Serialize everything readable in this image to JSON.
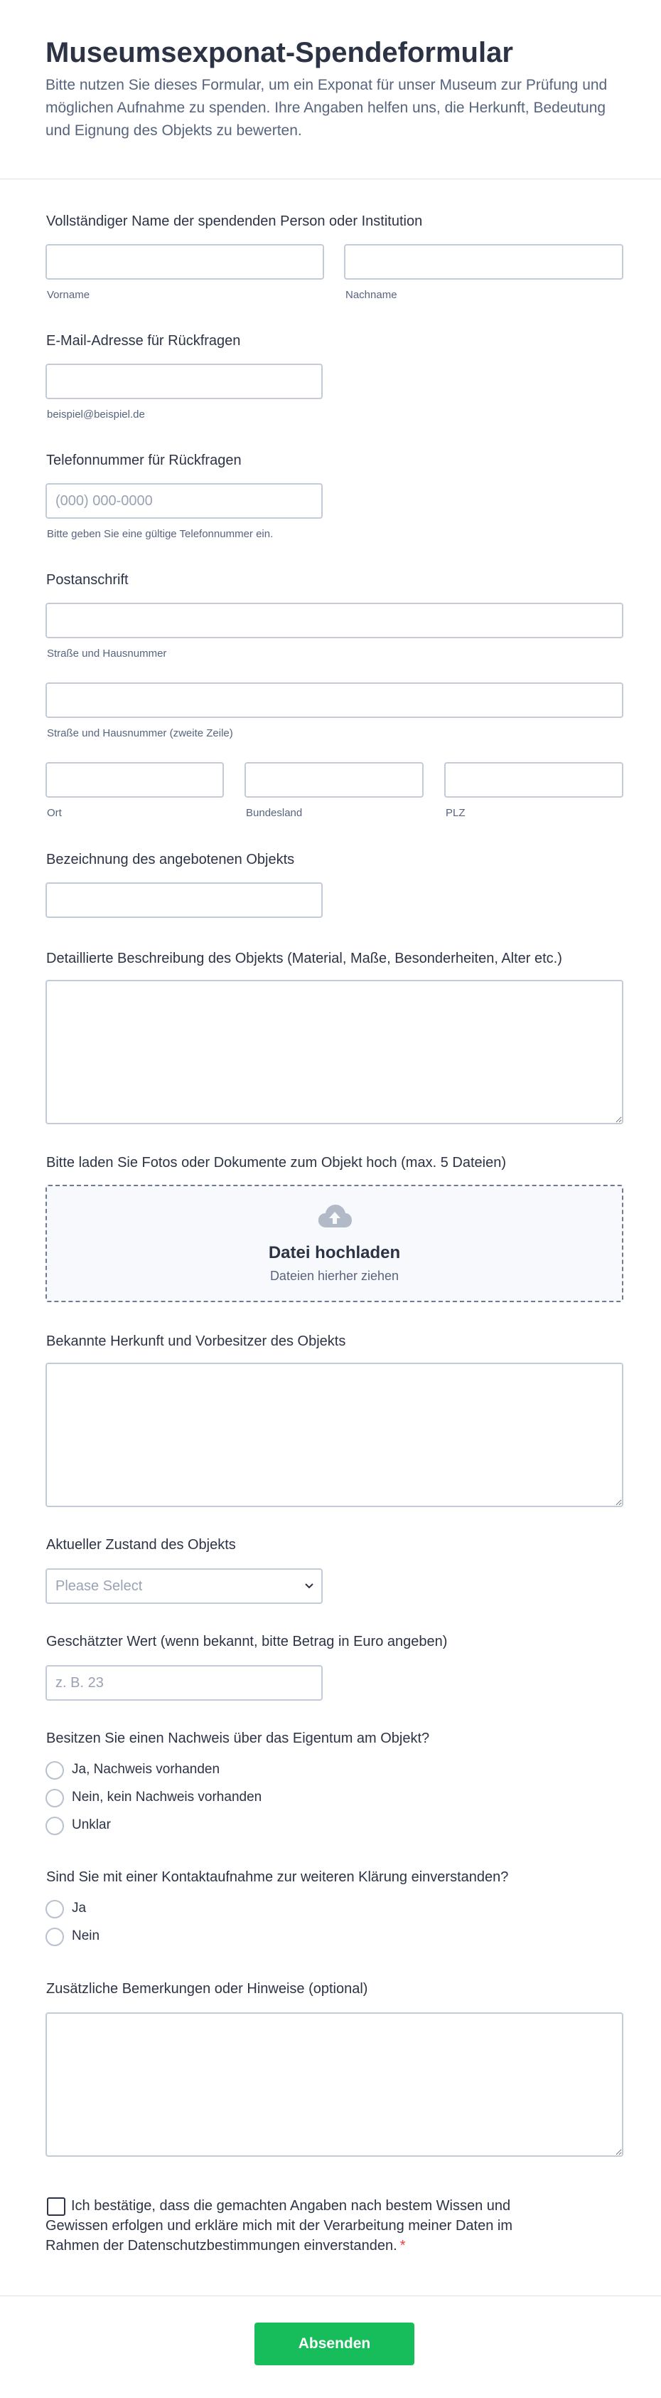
{
  "header": {
    "title": "Museumsexponat-Spendeformular",
    "subtitle": "Bitte nutzen Sie dieses Formular, um ein Exponat für unser Museum zur Prüfung und möglichen Aufnahme zu spenden. Ihre Angaben helfen uns, die Herkunft, Bedeutung und Eignung des Objekts zu bewerten."
  },
  "name": {
    "label": "Vollständiger Name der spendenden Person oder Institution",
    "first_sublabel": "Vorname",
    "last_sublabel": "Nachname"
  },
  "email": {
    "label": "E-Mail-Adresse für Rückfragen",
    "sublabel": "beispiel@beispiel.de"
  },
  "phone": {
    "label": "Telefonnummer für Rückfragen",
    "placeholder": "(000) 000-0000",
    "sublabel": "Bitte geben Sie eine gültige Telefonnummer ein."
  },
  "address": {
    "label": "Postanschrift",
    "street_sublabel": "Straße und Hausnummer",
    "street2_sublabel": "Straße und Hausnummer (zweite Zeile)",
    "city_sublabel": "Ort",
    "state_sublabel": "Bundesland",
    "zip_sublabel": "PLZ"
  },
  "object_name": {
    "label": "Bezeichnung des angebotenen Objekts"
  },
  "description": {
    "label": "Detaillierte Beschreibung des Objekts (Material, Maße, Besonderheiten, Alter etc.)"
  },
  "upload": {
    "label": "Bitte laden Sie Fotos oder Dokumente zum Objekt hoch (max. 5 Dateien)",
    "title": "Datei hochladen",
    "subtitle": "Dateien hierher ziehen",
    "icon": "cloud-upload-icon"
  },
  "provenance": {
    "label": "Bekannte Herkunft und Vorbesitzer des Objekts"
  },
  "condition": {
    "label": "Aktueller Zustand des Objekts",
    "selected": "Please Select"
  },
  "value": {
    "label": "Geschätzter Wert (wenn bekannt, bitte Betrag in Euro angeben)",
    "placeholder": "z. B. 23"
  },
  "ownership": {
    "label": "Besitzen Sie einen Nachweis über das Eigentum am Objekt?",
    "options": [
      "Ja, Nachweis vorhanden",
      "Nein, kein Nachweis vorhanden",
      "Unklar"
    ]
  },
  "contact": {
    "label": "Sind Sie mit einer Kontaktaufnahme zur weiteren Klärung einverstanden?",
    "options": [
      "Ja",
      "Nein"
    ]
  },
  "remarks": {
    "label": "Zusätzliche Bemerkungen oder Hinweise (optional)"
  },
  "consent": {
    "text": "Ich bestätige, dass die gemachten Angaben nach bestem Wissen und Gewissen erfolgen und erkläre mich mit der Verarbeitung meiner Daten im Rahmen der Datenschutzbestimmungen einverstanden.",
    "required_mark": "*"
  },
  "submit_label": "Absenden",
  "colors": {
    "accent": "#18bd5b",
    "required": "#f23a3c",
    "text": "#2c3345",
    "subtext": "#57647e",
    "border": "#c3cad8"
  }
}
